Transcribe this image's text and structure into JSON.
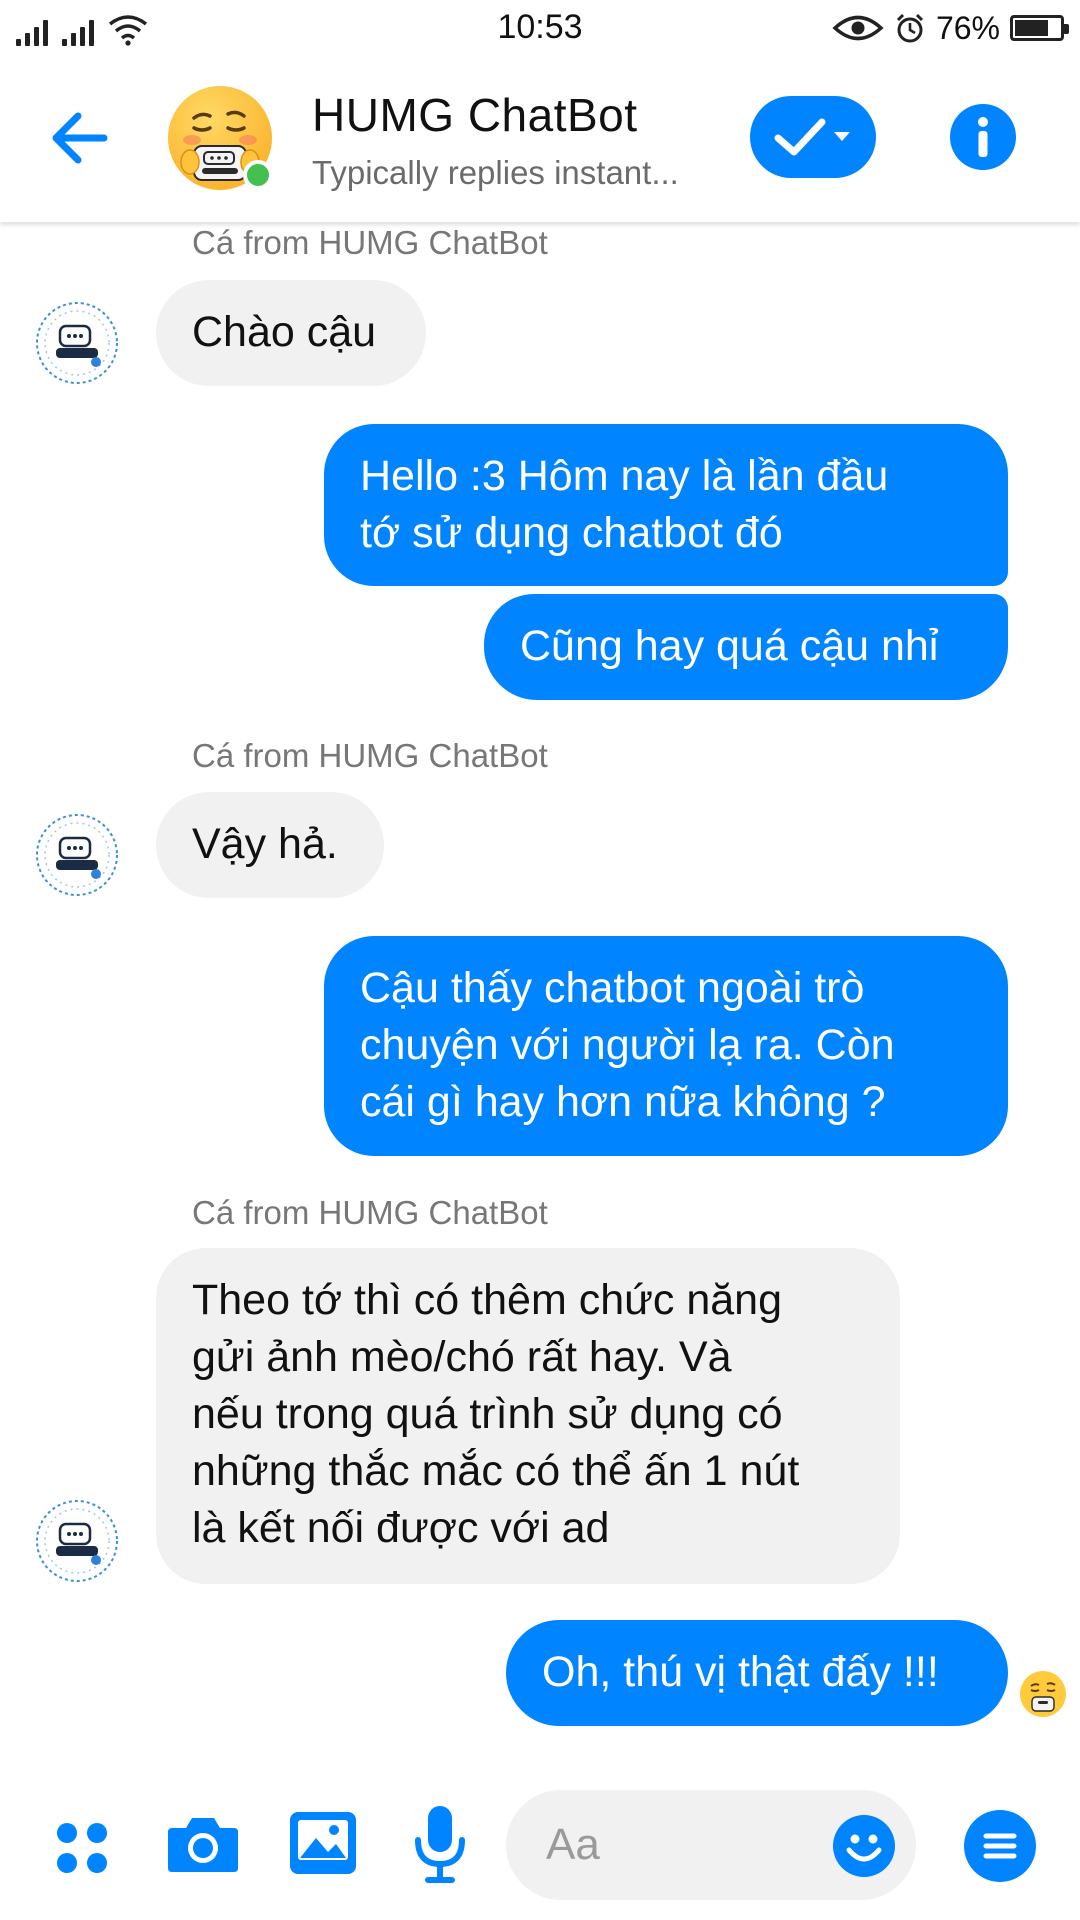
{
  "status_bar": {
    "time": "10:53",
    "battery_pct": "76%",
    "battery_level": 0.76
  },
  "header": {
    "back_icon": "arrow-left-icon",
    "title": "HUMG ChatBot",
    "subtitle": "Typically replies instant...",
    "check_icon": "check-dropdown-icon",
    "info_icon": "info-icon",
    "accent": "#0084ff",
    "online_color": "#43c04e"
  },
  "messages": [
    {
      "type": "label",
      "text": "Cá from HUMG ChatBot"
    },
    {
      "type": "received",
      "lines": [
        "Chào cậu"
      ]
    },
    {
      "type": "sent",
      "lines": [
        "Hello :3 Hôm nay là lần đầu",
        "tớ sử dụng chatbot đó"
      ]
    },
    {
      "type": "sent",
      "lines": [
        "Cũng hay quá cậu nhỉ"
      ]
    },
    {
      "type": "label",
      "text": "Cá from HUMG ChatBot"
    },
    {
      "type": "received",
      "lines": [
        "Vậy hả."
      ]
    },
    {
      "type": "sent",
      "lines": [
        "Cậu thấy chatbot ngoài trò",
        "chuyện với người lạ ra. Còn",
        "cái gì hay hơn nữa không ?"
      ]
    },
    {
      "type": "label",
      "text": "Cá from HUMG ChatBot"
    },
    {
      "type": "received",
      "lines": [
        "Theo tớ thì có thêm chức năng",
        "gửi ảnh mèo/chó rất hay. Và",
        "nếu trong quá trình sử dụng có",
        "những thắc mắc có thể ấn 1 nút",
        "là kết nối được với ad"
      ]
    },
    {
      "type": "sent",
      "lines": [
        "Oh, thú vị thật đấy !!!"
      ]
    }
  ],
  "bot_avatar_text": "HUMG Chatbot",
  "composer": {
    "placeholder": "Aa",
    "icons": [
      "apps-icon",
      "camera-icon",
      "image-icon",
      "microphone-icon",
      "emoji-icon",
      "menu-icon"
    ]
  }
}
